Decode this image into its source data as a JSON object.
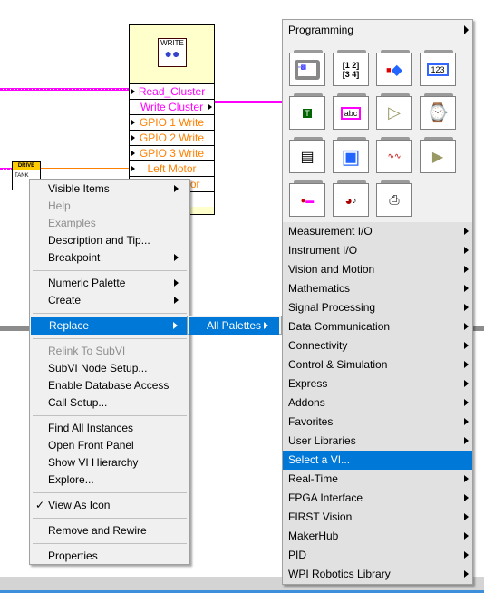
{
  "diagram": {
    "write_node": {
      "icon_label": "WRITE",
      "terminals": [
        {
          "label": "Read_Cluster",
          "color": "#ff00ff",
          "dir": "in"
        },
        {
          "label": "Write Cluster",
          "color": "#ff00ff",
          "dir": "out"
        },
        {
          "label": "GPIO 1 Write",
          "color": "#ff8000",
          "dir": "in"
        },
        {
          "label": "GPIO 2 Write",
          "color": "#ff8000",
          "dir": "in"
        },
        {
          "label": "GPIO 3 Write",
          "color": "#ff8000",
          "dir": "in"
        },
        {
          "label": "Left Motor",
          "color": "#ff8000",
          "dir": "in"
        },
        {
          "label": "Right Motor",
          "color": "#ff8000",
          "dir": "in"
        },
        {
          "label": "Enable",
          "color": "#008000",
          "dir": "in"
        }
      ]
    },
    "drive_node": {
      "header": "DRIVE",
      "body": "TANK"
    }
  },
  "context_menu": {
    "items": [
      {
        "label": "Visible Items",
        "submenu": true
      },
      {
        "label": "Help",
        "disabled": true
      },
      {
        "label": "Examples",
        "disabled": true
      },
      {
        "label": "Description and Tip..."
      },
      {
        "label": "Breakpoint",
        "submenu": true
      },
      {
        "separator": true
      },
      {
        "label": "Numeric Palette",
        "submenu": true
      },
      {
        "label": "Create",
        "submenu": true
      },
      {
        "separator": true
      },
      {
        "label": "Replace",
        "submenu": true,
        "selected": true
      },
      {
        "separator": true
      },
      {
        "label": "Relink To SubVI",
        "disabled": true
      },
      {
        "label": "SubVI Node Setup..."
      },
      {
        "label": "Enable Database Access"
      },
      {
        "label": "Call Setup..."
      },
      {
        "separator": true
      },
      {
        "label": "Find All Instances"
      },
      {
        "label": "Open Front Panel"
      },
      {
        "label": "Show VI Hierarchy"
      },
      {
        "label": "Explore..."
      },
      {
        "separator": true
      },
      {
        "label": "View As Icon",
        "checked": true
      },
      {
        "separator": true
      },
      {
        "label": "Remove and Rewire"
      },
      {
        "separator": true
      },
      {
        "label": "Properties"
      }
    ]
  },
  "submenu": {
    "label": "All Palettes"
  },
  "palette": {
    "title": "Programming",
    "icons": [
      "structures-icon",
      "array-icon",
      "cluster-class-variant-icon",
      "numeric-icon",
      "boolean-icon",
      "string-icon",
      "comparison-icon",
      "timing-icon",
      "dialog-ui-icon",
      "file-io-icon",
      "waveform-icon",
      "application-control-icon",
      "synchronization-icon",
      "graphics-sound-icon",
      "report-generation-icon"
    ],
    "categories": [
      {
        "label": "Measurement I/O"
      },
      {
        "label": "Instrument I/O"
      },
      {
        "label": "Vision and Motion"
      },
      {
        "label": "Mathematics"
      },
      {
        "label": "Signal Processing"
      },
      {
        "label": "Data Communication"
      },
      {
        "label": "Connectivity"
      },
      {
        "label": "Control & Simulation"
      },
      {
        "label": "Express"
      },
      {
        "label": "Addons"
      },
      {
        "label": "Favorites"
      },
      {
        "label": "User Libraries"
      },
      {
        "label": "Select a VI...",
        "selected": true,
        "noarrow": true
      },
      {
        "label": "Real-Time"
      },
      {
        "label": "FPGA Interface"
      },
      {
        "label": "FIRST Vision"
      },
      {
        "label": "MakerHub"
      },
      {
        "label": "PID"
      },
      {
        "label": "WPI Robotics Library"
      }
    ],
    "selection_color": "#0078d7"
  }
}
